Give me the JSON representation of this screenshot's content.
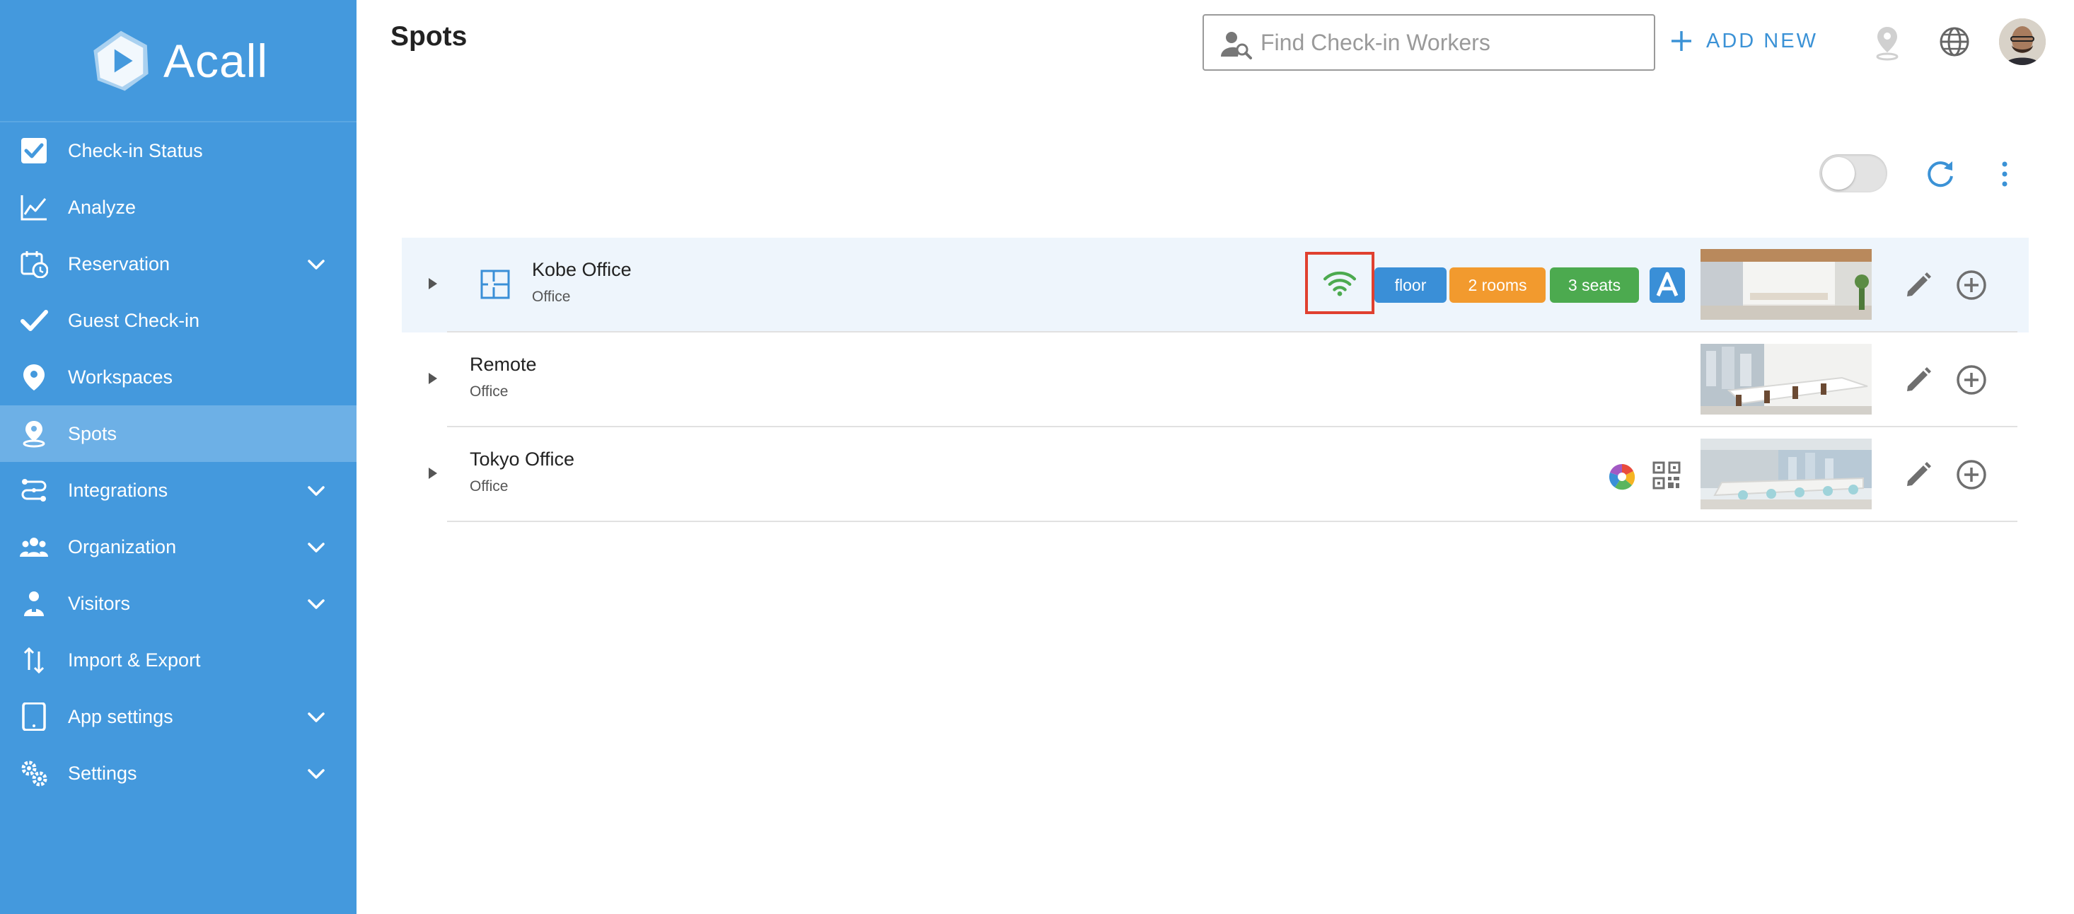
{
  "app": {
    "brand": "Acall",
    "accent_color": "#4499dd",
    "active_nav_color": "#6db0e6"
  },
  "sidebar": {
    "items": [
      {
        "label": "Check-in Status",
        "icon": "checkbox-icon",
        "has_chevron": false
      },
      {
        "label": "Analyze",
        "icon": "line-chart-icon",
        "has_chevron": false
      },
      {
        "label": "Reservation",
        "icon": "calendar-clock-icon",
        "has_chevron": true
      },
      {
        "label": "Guest Check-in",
        "icon": "checkmark-icon",
        "has_chevron": false
      },
      {
        "label": "Workspaces",
        "icon": "map-pin-icon",
        "has_chevron": false
      },
      {
        "label": "Spots",
        "icon": "spot-pin-icon",
        "has_chevron": false,
        "active": true
      },
      {
        "label": "Integrations",
        "icon": "integrations-icon",
        "has_chevron": true
      },
      {
        "label": "Organization",
        "icon": "people-icon",
        "has_chevron": true
      },
      {
        "label": "Visitors",
        "icon": "visitor-icon",
        "has_chevron": true
      },
      {
        "label": "Import & Export",
        "icon": "import-export-icon",
        "has_chevron": false
      },
      {
        "label": "App settings",
        "icon": "tablet-icon",
        "has_chevron": true
      },
      {
        "label": "Settings",
        "icon": "gears-icon",
        "has_chevron": true
      }
    ]
  },
  "header": {
    "title": "Spots",
    "search": {
      "placeholder": "Find Check-in Workers",
      "value": ""
    },
    "add_new_label": "ADD NEW"
  },
  "toolbar": {
    "toggle_on": false
  },
  "spots": [
    {
      "name": "Kobe Office",
      "type": "Office",
      "selected": true,
      "wifi_highlighted": true,
      "badges": {
        "floor": "floor",
        "rooms": "2 rooms",
        "seats": "3 seats"
      },
      "badge_colors": {
        "floor": "#3a8fd7",
        "rooms": "#f29a2e",
        "seats": "#4caa4f"
      },
      "app_label": "A"
    },
    {
      "name": "Remote",
      "type": "Office",
      "selected": false
    },
    {
      "name": "Tokyo Office",
      "type": "Office",
      "selected": false,
      "integration_icons": [
        "integration-logo-icon",
        "qr-code-icon"
      ]
    }
  ]
}
